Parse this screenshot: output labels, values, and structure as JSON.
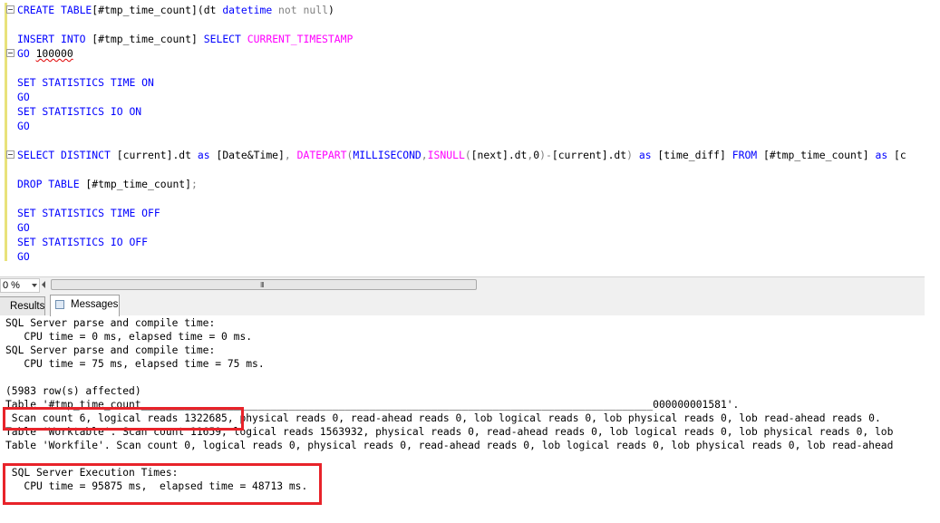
{
  "editor": {
    "lines": [
      {
        "row": 0,
        "fold": true,
        "segments": [
          [
            "kw",
            "CREATE TABLE"
          ],
          [
            "",
            "[#tmp_time_count]("
          ],
          [
            "",
            "dt "
          ],
          [
            "kw",
            "datetime"
          ],
          [
            "gr",
            " not null"
          ],
          [
            "",
            ")"
          ]
        ]
      },
      {
        "row": 2,
        "fold": false,
        "segments": [
          [
            "kw",
            "INSERT INTO"
          ],
          [
            "",
            " [#tmp_time_count] "
          ],
          [
            "kw",
            "SELECT"
          ],
          [
            "",
            " "
          ],
          [
            "fn",
            "CURRENT_TIMESTAMP"
          ]
        ]
      },
      {
        "row": 3,
        "fold": true,
        "segments": [
          [
            "kw",
            "GO"
          ],
          [
            "",
            " "
          ],
          [
            "sq",
            "100000"
          ]
        ]
      },
      {
        "row": 5,
        "fold": false,
        "segments": [
          [
            "kw",
            "SET STATISTICS TIME ON"
          ]
        ]
      },
      {
        "row": 6,
        "fold": false,
        "segments": [
          [
            "kw",
            "GO"
          ]
        ]
      },
      {
        "row": 7,
        "fold": false,
        "segments": [
          [
            "kw",
            "SET STATISTICS IO ON"
          ]
        ]
      },
      {
        "row": 8,
        "fold": false,
        "segments": [
          [
            "kw",
            "GO"
          ]
        ]
      },
      {
        "row": 10,
        "fold": true,
        "segments": [
          [
            "kw",
            "SELECT DISTINCT"
          ],
          [
            "",
            " [current].dt "
          ],
          [
            "kw",
            "as"
          ],
          [
            "",
            " [Date&Time]"
          ],
          [
            "gr",
            ", "
          ],
          [
            "fn",
            "DATEPART"
          ],
          [
            "gr",
            "("
          ],
          [
            "kw",
            "MILLISECOND"
          ],
          [
            "gr",
            ","
          ],
          [
            "fn",
            "ISNULL"
          ],
          [
            "gr",
            "("
          ],
          [
            "",
            "[next].dt"
          ],
          [
            "gr",
            ","
          ],
          [
            "",
            "0"
          ],
          [
            "gr",
            ")-"
          ],
          [
            "",
            "[current].dt"
          ],
          [
            "gr",
            ")"
          ],
          [
            "",
            " "
          ],
          [
            "kw",
            "as"
          ],
          [
            "",
            " [time_diff] "
          ],
          [
            "kw",
            "FROM"
          ],
          [
            "",
            " [#tmp_time_count] "
          ],
          [
            "kw",
            "as"
          ],
          [
            "",
            " [c"
          ]
        ]
      },
      {
        "row": 12,
        "fold": false,
        "segments": [
          [
            "kw",
            "DROP TABLE"
          ],
          [
            "",
            " [#tmp_time_count]"
          ],
          [
            "gr",
            ";"
          ]
        ]
      },
      {
        "row": 14,
        "fold": false,
        "segments": [
          [
            "kw",
            "SET STATISTICS TIME OFF"
          ]
        ]
      },
      {
        "row": 15,
        "fold": false,
        "segments": [
          [
            "kw",
            "GO"
          ]
        ]
      },
      {
        "row": 16,
        "fold": false,
        "segments": [
          [
            "kw",
            "SET STATISTICS IO OFF"
          ]
        ]
      },
      {
        "row": 17,
        "fold": false,
        "segments": [
          [
            "kw",
            "GO"
          ]
        ]
      }
    ]
  },
  "statusbar": {
    "zoom": "0 %",
    "grip": "III"
  },
  "tabs": {
    "results": "Results",
    "messages": "Messages"
  },
  "messages": {
    "lines": [
      "SQL Server parse and compile time:",
      "   CPU time = 0 ms, elapsed time = 0 ms.",
      "SQL Server parse and compile time:",
      "   CPU time = 75 ms, elapsed time = 75 ms.",
      "",
      "(5983 row(s) affected)",
      "Table '#tmp_time_count___________________________________________________________________________________000000001581'.",
      " Scan count 6, logical reads 1322685, physical reads 0, read-ahead reads 0, lob logical reads 0, lob physical reads 0, lob read-ahead reads 0.",
      "Table 'Worktable'. Scan count 11659, logical reads 1563932, physical reads 0, read-ahead reads 0, lob logical reads 0, lob physical reads 0, lob",
      "Table 'Workfile'. Scan count 0, logical reads 0, physical reads 0, read-ahead reads 0, lob logical reads 0, lob physical reads 0, lob read-ahead",
      "",
      " SQL Server Execution Times:",
      "   CPU time = 95875 ms,  elapsed time = 48713 ms."
    ]
  },
  "colors": {
    "highlight": "#e8232a",
    "keyword": "#0000ff",
    "function": "#ff00ff",
    "operator": "#808080"
  }
}
